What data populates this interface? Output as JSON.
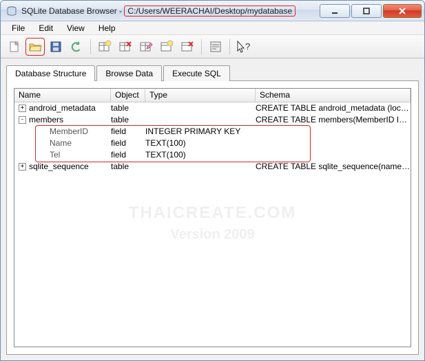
{
  "window": {
    "app_name": "SQLite Database Browser",
    "path": "C:/Users/WEERACHAI/Desktop/mydatabase"
  },
  "menu": {
    "items": [
      "File",
      "Edit",
      "View",
      "Help"
    ]
  },
  "toolbar": {
    "buttons": [
      {
        "name": "new-db-icon"
      },
      {
        "name": "open-db-icon"
      },
      {
        "name": "save-db-icon"
      },
      {
        "name": "revert-icon"
      },
      {
        "name": "create-table-icon"
      },
      {
        "name": "delete-table-icon"
      },
      {
        "name": "modify-table-icon"
      },
      {
        "name": "create-index-icon"
      },
      {
        "name": "delete-index-icon"
      },
      {
        "name": "log-icon"
      },
      {
        "name": "whatsthis-icon"
      }
    ]
  },
  "tabs": {
    "items": [
      "Database Structure",
      "Browse Data",
      "Execute SQL"
    ],
    "active": 0
  },
  "tree": {
    "headers": {
      "name": "Name",
      "object": "Object",
      "type": "Type",
      "schema": "Schema"
    },
    "rows": [
      {
        "level": 1,
        "expander": "+",
        "name": "android_metadata",
        "object": "table",
        "type": "",
        "schema": "CREATE TABLE android_metadata (locale TEXT)"
      },
      {
        "level": 1,
        "expander": "-",
        "name": "members",
        "object": "table",
        "type": "",
        "schema": "CREATE TABLE members(MemberID INTEGER PRI..."
      },
      {
        "level": 2,
        "expander": "",
        "name": "MemberID",
        "object": "field",
        "type": "INTEGER PRIMARY KEY",
        "schema": ""
      },
      {
        "level": 2,
        "expander": "",
        "name": "Name",
        "object": "field",
        "type": "TEXT(100)",
        "schema": ""
      },
      {
        "level": 2,
        "expander": "",
        "name": "Tel",
        "object": "field",
        "type": "TEXT(100)",
        "schema": ""
      },
      {
        "level": 1,
        "expander": "+",
        "name": "sqlite_sequence",
        "object": "table",
        "type": "",
        "schema": "CREATE TABLE sqlite_sequence(name,seq)"
      }
    ]
  },
  "watermark": {
    "line1": "THAICREATE.COM",
    "line2": "Version 2009"
  }
}
